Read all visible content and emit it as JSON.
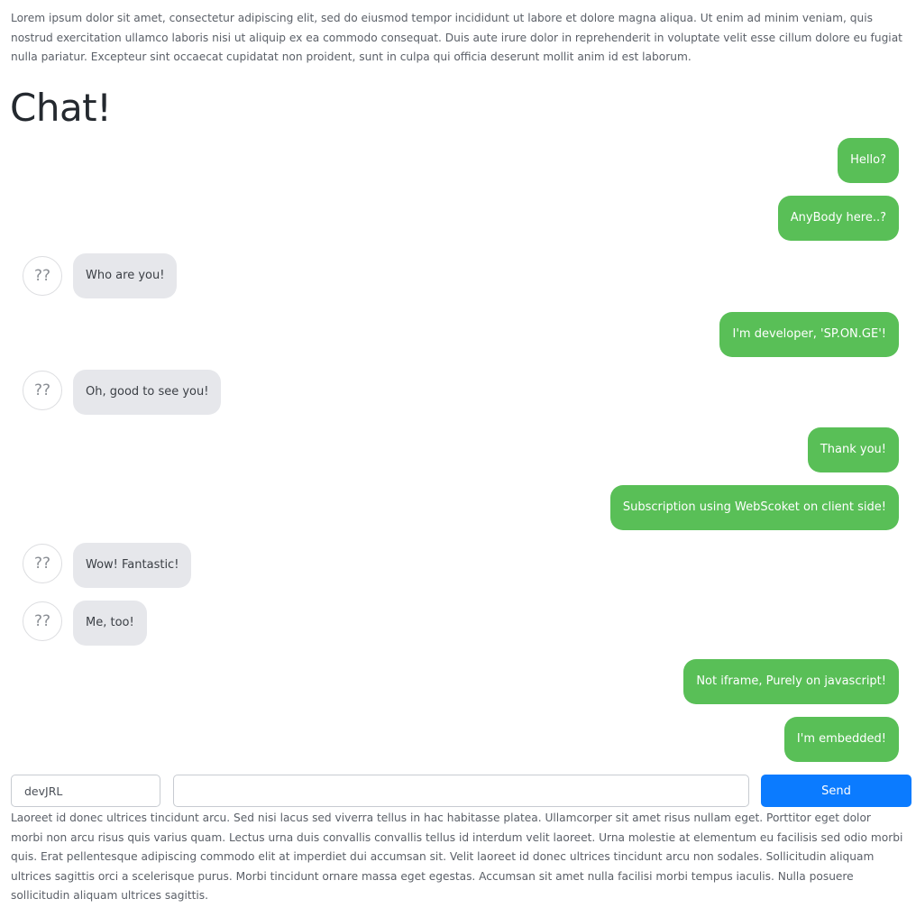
{
  "intro_text": "Lorem ipsum dolor sit amet, consectetur adipiscing elit, sed do eiusmod tempor incididunt ut labore et dolore magna aliqua. Ut enim ad minim veniam, quis nostrud exercitation ullamco laboris nisi ut aliquip ex ea commodo consequat. Duis aute irure dolor in reprehenderit in voluptate velit esse cillum dolore eu fugiat nulla pariatur. Excepteur sint occaecat cupidatat non proident, sunt in culpa qui officia deserunt mollit anim id est laborum.",
  "title": "Chat!",
  "avatar_label": "??",
  "messages": [
    {
      "side": "out",
      "text": "Hello?"
    },
    {
      "side": "out",
      "text": "AnyBody here..?"
    },
    {
      "side": "in",
      "text": "Who are you!"
    },
    {
      "side": "out",
      "text": "I'm developer, 'SP.ON.GE'!"
    },
    {
      "side": "in",
      "text": "Oh, good to see you!"
    },
    {
      "side": "out",
      "text": "Thank you!"
    },
    {
      "side": "out",
      "text": "Subscription using WebScoket on client side!"
    },
    {
      "side": "in",
      "text": "Wow! Fantastic!"
    },
    {
      "side": "in",
      "text": "Me, too!"
    },
    {
      "side": "out",
      "text": "Not iframe, Purely on javascript!"
    },
    {
      "side": "out",
      "text": "I'm embedded!"
    }
  ],
  "composer": {
    "name_value": "devJRL",
    "message_value": "",
    "send_label": "Send"
  },
  "footer_text": "Laoreet id donec ultrices tincidunt arcu. Sed nisi lacus sed viverra tellus in hac habitasse platea. Ullamcorper sit amet risus nullam eget. Porttitor eget dolor morbi non arcu risus quis varius quam. Lectus urna duis convallis convallis tellus id interdum velit laoreet. Urna molestie at elementum eu facilisis sed odio morbi quis. Erat pellentesque adipiscing commodo elit at imperdiet dui accumsan sit. Velit laoreet id donec ultrices tincidunt arcu non sodales. Sollicitudin aliquam ultrices sagittis orci a scelerisque purus. Morbi tincidunt ornare massa eget egestas. Accumsan sit amet nulla facilisi morbi tempus iaculis. Nulla posuere sollicitudin aliquam ultrices sagittis.",
  "colors": {
    "outgoing_bubble": "#59bf57",
    "incoming_bubble": "#e6e7eb",
    "send_button": "#0b7bff"
  }
}
